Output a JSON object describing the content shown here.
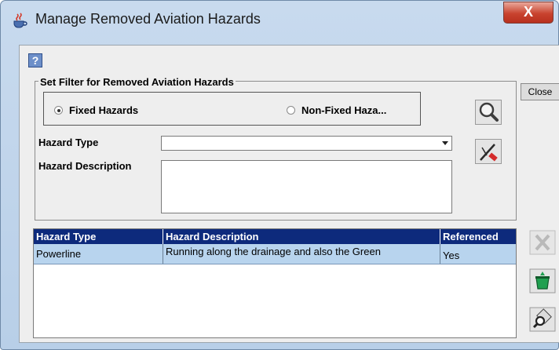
{
  "window": {
    "title": "Manage Removed Aviation Hazards",
    "close_glyph": "X"
  },
  "icons": {
    "app": "java-coffee-icon",
    "help": "help-icon",
    "search": "magnifier-search-icon",
    "clear": "eraser-clear-icon",
    "delete": "delete-x-icon",
    "restore": "restore-bin-icon",
    "view": "view-details-icon"
  },
  "filter": {
    "legend": "Set Filter for Removed Aviation Hazards",
    "radios": [
      {
        "label": "Fixed Hazards",
        "selected": true
      },
      {
        "label": "Non-Fixed Haza...",
        "selected": false
      }
    ],
    "hazard_type_label": "Hazard Type",
    "hazard_type_value": "",
    "hazard_description_label": "Hazard Description",
    "hazard_description_value": ""
  },
  "buttons": {
    "close": "Close"
  },
  "table": {
    "columns": [
      "Hazard Type",
      "Hazard Description",
      "Referenced"
    ],
    "rows": [
      {
        "hazard_type": "Powerline",
        "hazard_description": "Running along the drainage and also the Green",
        "referenced": "Yes"
      }
    ]
  },
  "colors": {
    "header_bg": "#0d2a7c",
    "selected_row": "#b8d4ee",
    "window_frame": "#c8daee"
  }
}
